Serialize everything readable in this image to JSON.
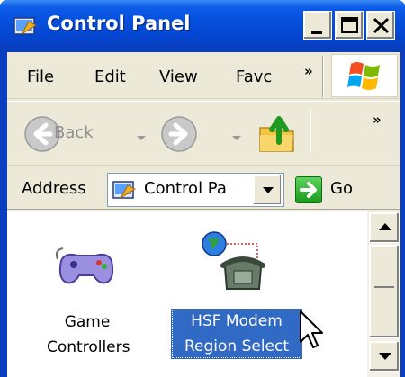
{
  "window": {
    "title": "Control Panel"
  },
  "menu": {
    "items": [
      "File",
      "Edit",
      "View",
      "Favc"
    ],
    "overflow": "»"
  },
  "toolbar": {
    "back_label": "Back",
    "overflow": "»"
  },
  "address": {
    "label": "Address",
    "value": "Control Pa",
    "go_label": "Go"
  },
  "items": [
    {
      "label_line1": "Game",
      "label_line2": "Controllers",
      "icon": "gamepad-icon",
      "selected": false
    },
    {
      "label_line1": "HSF Modem",
      "label_line2": "Region Select",
      "icon": "modem-phone-icon",
      "selected": true
    }
  ],
  "colors": {
    "titlebar": "#0550dd",
    "selection": "#316ac5",
    "chrome": "#ece9d8"
  }
}
